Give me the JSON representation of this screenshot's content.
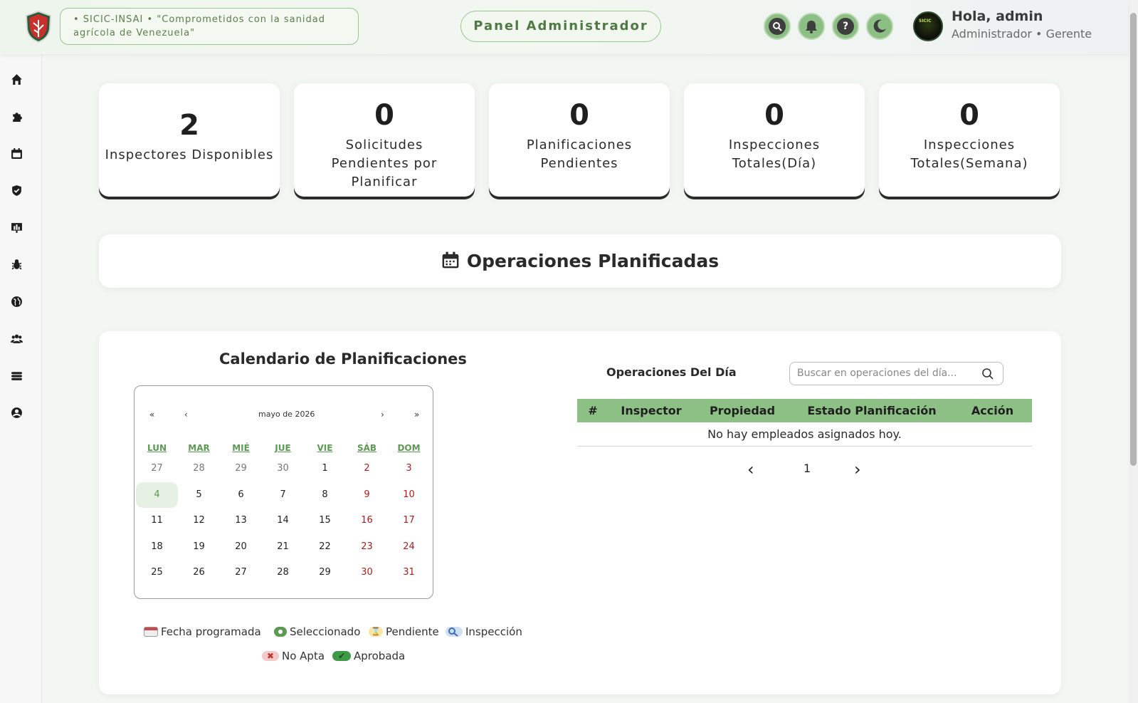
{
  "header": {
    "motto": "• SICIC-INSAI • \"Comprometidos con la sanidad agrícola de Venezuela\"",
    "panel_label": "Panel Administrador",
    "icons": [
      "search-icon",
      "bell-icon",
      "help-icon",
      "moon-icon"
    ],
    "greeting": "Hola, admin",
    "role": "Administrador • Gerente",
    "avatar_text": "SICIC"
  },
  "sidebar": {
    "items": [
      "home-icon",
      "puzzle-icon",
      "calendar-icon",
      "shield-icon",
      "chart-icon",
      "bug-icon",
      "globe-icon",
      "users-icon",
      "database-icon",
      "user-circle-icon"
    ]
  },
  "stats": [
    {
      "value": "2",
      "label": "Inspectores Disponibles"
    },
    {
      "value": "0",
      "label": "Solicitudes Pendientes por Planificar"
    },
    {
      "value": "0",
      "label": "Planificaciones Pendientes"
    },
    {
      "value": "0",
      "label": "Inspecciones Totales(Día)"
    },
    {
      "value": "0",
      "label": "Inspecciones Totales(Semana)"
    }
  ],
  "operations_title": "Operaciones Planificadas",
  "calendar": {
    "title": "Calendario de Planificaciones",
    "nav": {
      "prev_year": "«",
      "prev_month": "‹",
      "month_label": "mayo de 2026",
      "next_month": "›",
      "next_year": "»"
    },
    "weekdays": [
      "LUN",
      "MAR",
      "MIÉ",
      "JUE",
      "VIE",
      "SÁB",
      "DOM"
    ],
    "weeks": [
      [
        "27",
        "28",
        "29",
        "30",
        "1",
        "2",
        "3"
      ],
      [
        "4",
        "5",
        "6",
        "7",
        "8",
        "9",
        "10"
      ],
      [
        "11",
        "12",
        "13",
        "14",
        "15",
        "16",
        "17"
      ],
      [
        "18",
        "19",
        "20",
        "21",
        "22",
        "23",
        "24"
      ],
      [
        "25",
        "26",
        "27",
        "28",
        "29",
        "30",
        "31"
      ]
    ],
    "today": "4"
  },
  "legend": [
    {
      "label": "Fecha programada",
      "icon": "calendar-icon",
      "color": "#c94a4a"
    },
    {
      "label": "Seleccionado",
      "icon": "dot-icon",
      "color": "#5b9a52"
    },
    {
      "label": "Pendiente",
      "icon": "hourglass-icon",
      "color": "#f0c64a"
    },
    {
      "label": "Inspección",
      "icon": "magnifier-icon",
      "color": "#8fb7e6"
    },
    {
      "label": "No Apta",
      "icon": "x-icon",
      "color": "#e07070"
    },
    {
      "label": "Aprobada",
      "icon": "check-icon",
      "color": "#3e9a46"
    }
  ],
  "day_ops": {
    "title": "Operaciones Del Día",
    "search_placeholder": "Buscar en operaciones del día...",
    "columns": [
      "#",
      "Inspector",
      "Propiedad",
      "Estado Planificación",
      "Acción"
    ],
    "empty_text": "No hay empleados asignados hoy.",
    "pager": {
      "prev": "‹",
      "page": "1",
      "next": "›"
    }
  },
  "colors": {
    "accent": "#8cc084",
    "weekend": "#b01c1c",
    "brand_green": "#4f7a45"
  }
}
